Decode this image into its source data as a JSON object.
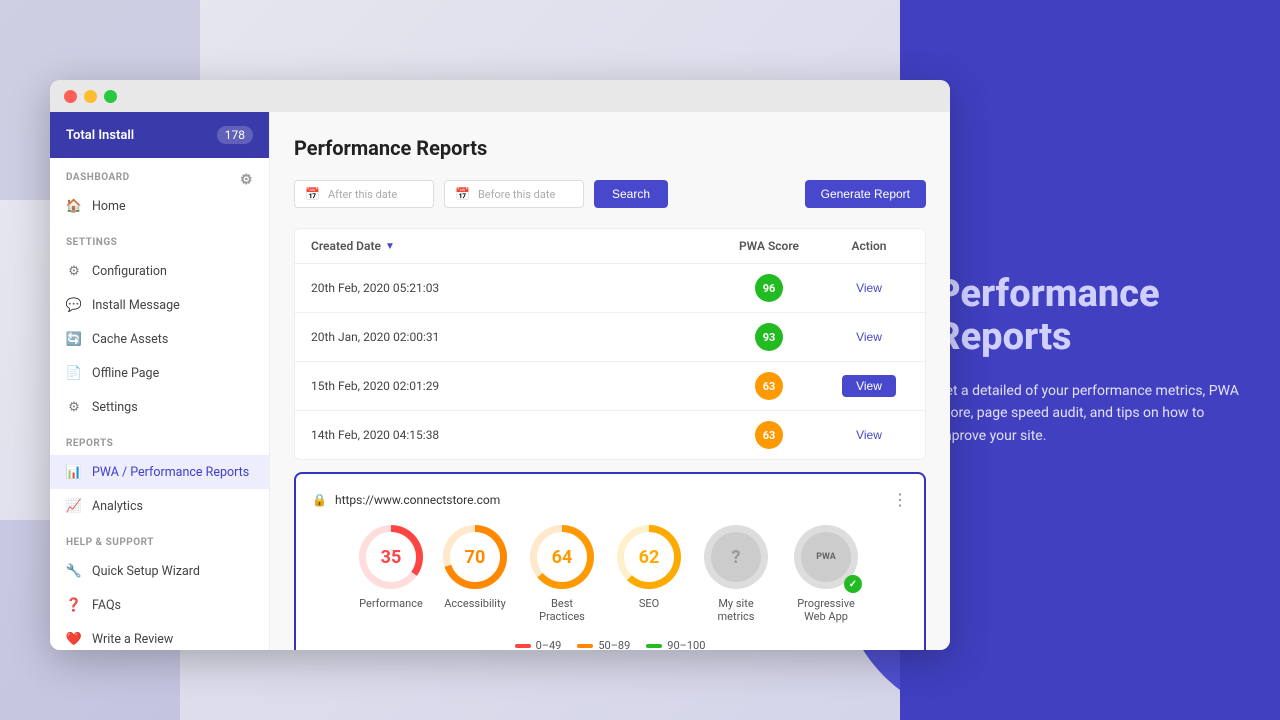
{
  "background": {
    "icon": "🔒"
  },
  "browser": {
    "titlebar": {
      "controls": [
        "red",
        "yellow",
        "green"
      ]
    }
  },
  "sidebar": {
    "header": {
      "title": "Total Install",
      "badge": "178"
    },
    "sections": [
      {
        "label": "DASHBOARD",
        "items": [
          {
            "id": "home",
            "label": "Home",
            "icon": "🏠",
            "active": false
          }
        ]
      },
      {
        "label": "SETTINGS",
        "items": [
          {
            "id": "configuration",
            "label": "Configuration",
            "icon": "⚙",
            "active": false
          },
          {
            "id": "install-message",
            "label": "Install Message",
            "icon": "💬",
            "active": false
          },
          {
            "id": "cache-assets",
            "label": "Cache Assets",
            "icon": "🔄",
            "active": false
          },
          {
            "id": "offline-page",
            "label": "Offline Page",
            "icon": "📄",
            "active": false
          },
          {
            "id": "settings",
            "label": "Settings",
            "icon": "⚙",
            "active": false
          }
        ]
      },
      {
        "label": "REPORTS",
        "items": [
          {
            "id": "pwa-reports",
            "label": "PWA / Performance Reports",
            "icon": "📊",
            "active": true
          },
          {
            "id": "analytics",
            "label": "Analytics",
            "icon": "📈",
            "active": false
          }
        ]
      },
      {
        "label": "HELP & SUPPORT",
        "items": [
          {
            "id": "quick-setup",
            "label": "Quick Setup Wizard",
            "icon": "🔧",
            "active": false
          },
          {
            "id": "faqs",
            "label": "FAQs",
            "icon": "❓",
            "active": false
          },
          {
            "id": "write-review",
            "label": "Write a Review",
            "icon": "❤️",
            "active": false
          }
        ]
      }
    ]
  },
  "main": {
    "page_title": "Performance Reports",
    "filters": {
      "date_after_placeholder": "After this date",
      "date_before_placeholder": "Before this date",
      "search_label": "Search",
      "generate_label": "Generate Report"
    },
    "table": {
      "columns": [
        "Created Date",
        "PWA Score",
        "Action"
      ],
      "rows": [
        {
          "date": "20th Feb, 2020 05:21:03",
          "pwa_score": "96",
          "score_color": "green",
          "action": "View"
        },
        {
          "date": "20th Jan, 2020 02:00:31",
          "pwa_score": "93",
          "score_color": "green",
          "action": "View"
        },
        {
          "date": "15th Feb, 2020 02:01:29",
          "pwa_score": "63",
          "score_color": "orange",
          "action": "View",
          "highlighted": true
        },
        {
          "date": "14th Feb, 2020 04:15:38",
          "pwa_score": "63",
          "score_color": "orange",
          "action": "View"
        }
      ]
    },
    "overlay": {
      "url": "https://www.connectstore.com",
      "metrics": [
        {
          "id": "performance",
          "value": "35",
          "type": "red",
          "label": "Performance"
        },
        {
          "id": "accessibility",
          "value": "70",
          "type": "orange",
          "label": "Accessibility"
        },
        {
          "id": "best-practices",
          "value": "64",
          "type": "orange2",
          "label": "Best Practices"
        },
        {
          "id": "seo",
          "value": "62",
          "type": "orange3",
          "label": "SEO"
        },
        {
          "id": "my-site",
          "value": "?",
          "type": "gray",
          "label": "My site metrics"
        },
        {
          "id": "pwa",
          "value": "PWA",
          "type": "pwa",
          "label": "Progressive Web App"
        }
      ],
      "legend": [
        {
          "range": "0–49",
          "color": "red"
        },
        {
          "range": "50–89",
          "color": "orange"
        },
        {
          "range": "90–100",
          "color": "green"
        }
      ]
    }
  },
  "right_panel": {
    "title_line1": "Performance",
    "title_line2": "Reports",
    "description": "Get a detailed of your performance metrics, PWA score, page speed audit, and tips on how to improve your site."
  }
}
